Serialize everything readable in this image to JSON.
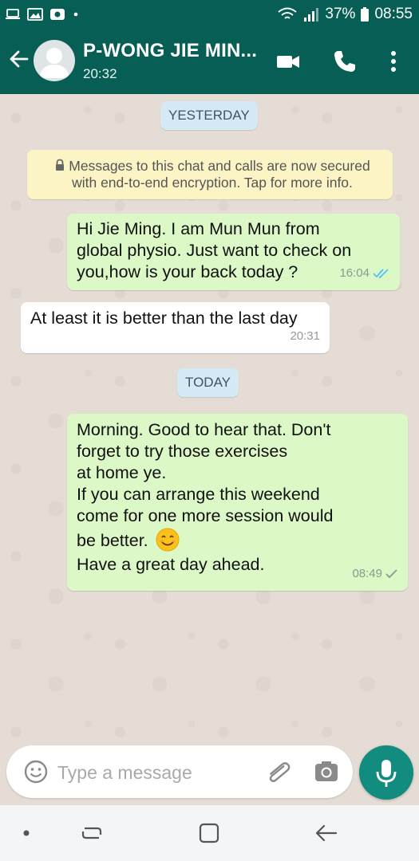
{
  "status_bar": {
    "battery": "37%",
    "time": "08:55"
  },
  "header": {
    "contact_name": "P-WONG JIE MIN...",
    "last_seen": "20:32"
  },
  "chat": {
    "day_yesterday": "YESTERDAY",
    "encryption_notice": "Messages to this chat and calls are now secured with end-to-end encryption. Tap for more info.",
    "messages": [
      {
        "direction": "outgoing",
        "text": "Hi Jie Ming. I am Mun Mun from\nglobal physio. Just want to check on\nyou,how is your back today ?",
        "time": "16:04",
        "status": "read"
      },
      {
        "direction": "incoming",
        "text": "At least it is better than the last day",
        "time": "20:31"
      },
      {
        "direction": "outgoing",
        "text_lines": [
          "Morning. Good to hear that. Don't",
          "forget to try those exercises",
          "at home ye.",
          "If you can arrange this weekend",
          "come for one more session would",
          "be better."
        ],
        "text_after_emoji": "Have a great day ahead.",
        "emoji": "smiling-face",
        "time": "08:49",
        "status": "delivered"
      }
    ],
    "day_today": "TODAY"
  },
  "input": {
    "placeholder": "Type a message",
    "value": ""
  },
  "colors": {
    "header": "#075e54",
    "outgoing_bubble": "#dcf8c6",
    "incoming_bubble": "#ffffff",
    "accent": "#128c7e",
    "read_ticks": "#4fc3f7"
  },
  "icons": {
    "back": "arrow-left-icon",
    "video": "video-call-icon",
    "call": "phone-icon",
    "menu": "more-vert-icon",
    "emoji": "emoji-icon",
    "attach": "paperclip-icon",
    "camera": "camera-icon",
    "mic": "mic-icon"
  }
}
